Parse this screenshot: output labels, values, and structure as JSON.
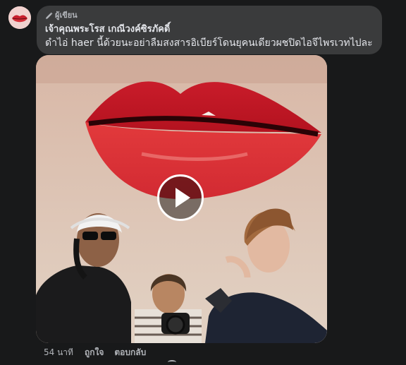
{
  "comment": {
    "author_badge": "ผู้เขียน",
    "author_name": "เจ้าคุณพระโรส เกณีวงค์ซิรภัคดิ์",
    "text": "ดำไอ่ haer นี้ด้วยนะอย่าลืมสงสารอิเบียร์โดนยุคนเดียวผชปิดไอจีไพรเวทไปละ",
    "avatar_icon": "lips-avatar",
    "badge_icon": "pencil-icon"
  },
  "media": {
    "type": "video",
    "play_icon": "play-icon"
  },
  "actions": {
    "time": "54 นาที",
    "like": "ถูกใจ",
    "reply": "ตอบกลับ"
  },
  "colors": {
    "background": "#18191a",
    "bubble": "#3a3b3c",
    "text_primary": "#e4e6eb",
    "text_secondary": "#b0b3b8"
  }
}
